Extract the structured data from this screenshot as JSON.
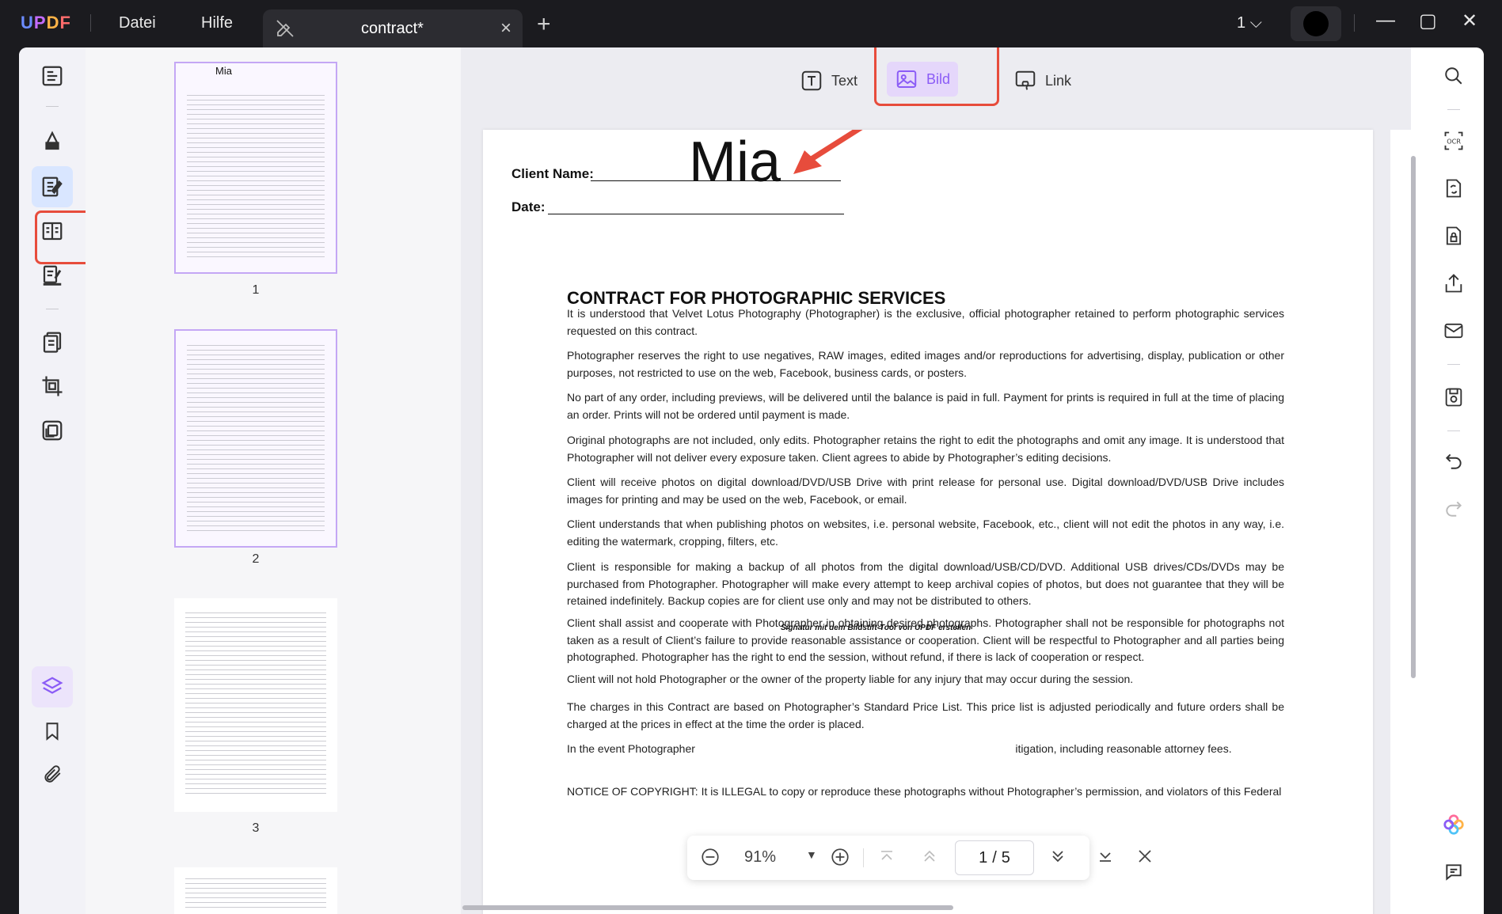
{
  "titlebar": {
    "logo": "UPDF",
    "menu": [
      "Datei",
      "Hilfe"
    ],
    "tab_title": "contract*",
    "new_tab": "+",
    "page_indicator": "1"
  },
  "edit_toolbar": {
    "text_label": "Text",
    "image_label": "Bild",
    "link_label": "Link"
  },
  "thumbnails": [
    {
      "num": "1",
      "sig": "Mia"
    },
    {
      "num": "2"
    },
    {
      "num": "3"
    }
  ],
  "document": {
    "client_label": "Client Name:",
    "date_label": "Date:",
    "signature": "Mia",
    "title": "CONTRACT FOR PHOTOGRAPHIC SERVICES",
    "paragraphs": [
      "It is understood that Velvet Lotus Photography (Photographer) is the exclusive, official photographer retained to perform photographic services requested on this contract.",
      "Photographer reserves the right to use negatives, RAW images, edited images and/or reproductions for advertising, display, publication or other purposes, not restricted to use on the web, Facebook, business cards, or posters.",
      "No part of any order, including previews, will be delivered until the balance is paid in full. Payment for prints is required in full at the time of placing an order. Prints will not be ordered until payment is made.",
      "Original photographs are not included, only edits. Photographer retains the right to edit the photographs and omit any image. It is understood that Photographer will not deliver every exposure taken. Client agrees to abide by Photographer’s editing decisions.",
      "Client will receive photos on digital download/DVD/USB Drive with print release for personal use. Digital download/DVD/USB Drive includes images for printing and may be used on the web, Facebook, or email.",
      "Client understands that when publishing photos on websites, i.e. personal website, Facebook, etc., client will not edit the photos in any way, i.e. editing the watermark, cropping, filters, etc.",
      "Client is responsible for making a backup of all photos from the digital download/USB/CD/DVD. Additional USB drives/CDs/DVDs may be purchased from Photographer. Photographer will make every attempt to keep archival copies of photos, but does not guarantee that they will be retained indefinitely. Backup copies are for client use only and may not be distributed to others.",
      "Client shall assist and cooperate with Photographer in obtaining desired photographs. Photographer shall not be responsible for photographs not taken as a result of Client’s failure to provide reasonable assistance or cooperation. Client will be respectful to Photographer and all parties being photographed. Photographer has the right to end the session, without refund, if there is lack of cooperation or respect.",
      "Client will not hold Photographer or the owner of the property liable for any injury that may occur during the session.",
      "The charges in this Contract are based on Photographer’s Standard Price List. This price list is adjusted periodically and future orders shall be charged at the prices in effect at the time the order is placed.",
      "In the event Photographer                                                                                                        itigation, including reasonable attorney fees.",
      "NOTICE OF COPYRIGHT: It is ILLEGAL to copy or reproduce these photographs without Photographer’s permission, and violators of this Federal"
    ],
    "overlay_note": "Signatur mit dem Bildstift-Tool von UPDF erstellen"
  },
  "zoombar": {
    "zoom": "91%",
    "current_page": "1",
    "separator": "/",
    "total_pages": "5"
  },
  "colors": {
    "accent": "#8b5cf6",
    "highlight_box": "#e74c3c"
  }
}
